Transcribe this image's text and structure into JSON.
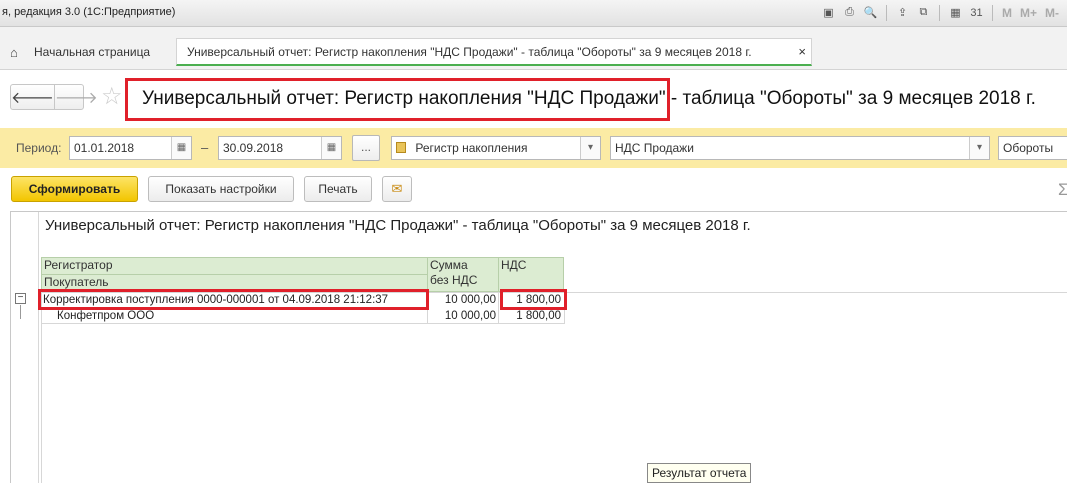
{
  "window": {
    "title": "я, редакция 3.0  (1С:Предприятие)",
    "right_markers": [
      "M",
      "M+",
      "M-"
    ]
  },
  "tabs": {
    "home_label": "Начальная страница",
    "active_label": "Универсальный отчет: Регистр накопления \"НДС Продажи\" - таблица \"Обороты\" за 9 месяцев 2018 г.",
    "close_symbol": "×"
  },
  "header": {
    "title": "Универсальный отчет: Регистр накопления \"НДС Продажи\" - таблица \"Обороты\" за 9 месяцев 2018 г."
  },
  "params": {
    "period_label": "Период:",
    "date_from": "01.01.2018",
    "date_to": "30.09.2018",
    "dash": "–",
    "dots": "...",
    "source_type": "Регистр накопления",
    "source_name": "НДС Продажи",
    "table_type": "Обороты"
  },
  "actions": {
    "generate": "Сформировать",
    "show_settings": "Показать настройки",
    "print": "Печать",
    "sigma": "Σ"
  },
  "report": {
    "title": "Универсальный отчет: Регистр накопления \"НДС Продажи\" - таблица \"Обороты\" за 9 месяцев 2018 г.",
    "columns": {
      "registrar": "Регистратор",
      "buyer": "Покупатель",
      "sum_line1": "Сумма",
      "sum_line2": "без НДС",
      "vat": "НДС"
    },
    "rows": [
      {
        "name": "Корректировка поступления 0000-000001 от 04.09.2018 21:12:37",
        "sum": "10 000,00",
        "vat": "1 800,00"
      },
      {
        "name": "Конфетпром ООО",
        "sum": "10 000,00",
        "vat": "1 800,00"
      }
    ],
    "tooltip": "Результат отчета"
  },
  "colors": {
    "highlight": "#e0202a",
    "params_bg": "#fbeba4",
    "header_bg": "#dcecd2",
    "primary_btn": "#f2c500"
  }
}
